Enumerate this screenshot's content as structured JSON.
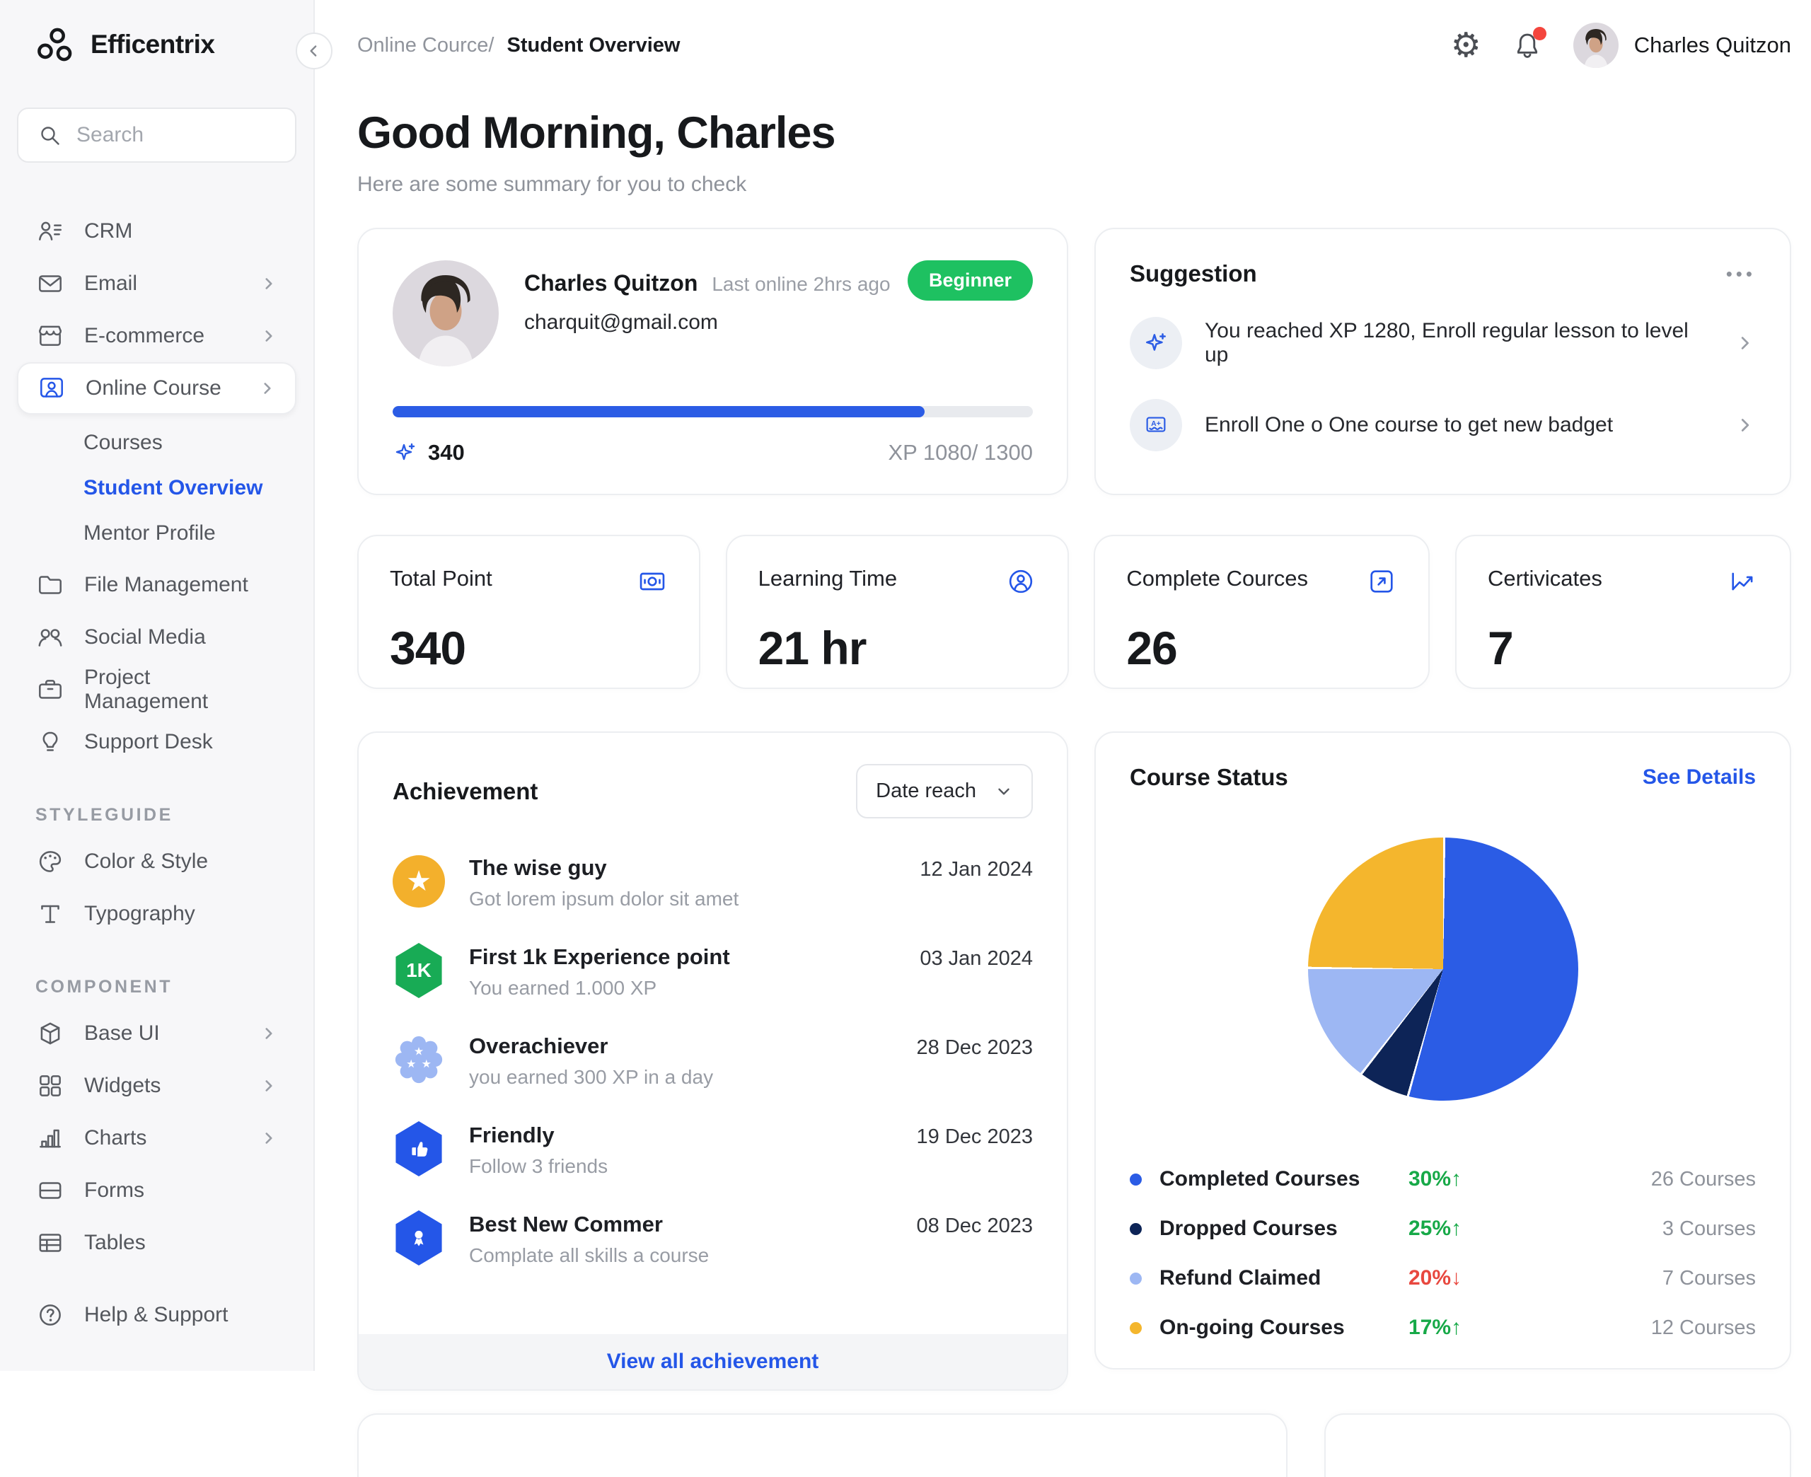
{
  "app": {
    "name": "Efficentrix"
  },
  "colors": {
    "primary_blue": "#2b5ce5",
    "link_blue": "#2456e8",
    "badge_green": "#1ec161",
    "trend_green": "#17a948",
    "trend_red": "#e8483f",
    "navy": "#0d2457",
    "light_blue": "#9db7f3",
    "yellow": "#f4b62d"
  },
  "icons": {
    "gear": "⚙",
    "more": "•••"
  },
  "sidebar": {
    "search_placeholder": "Search",
    "menu": [
      "CRM",
      "Email",
      "E-commerce",
      "Online Course"
    ],
    "online_course_children": [
      "Courses",
      "Student Overview",
      "Mentor Profile"
    ],
    "menu2": [
      "File Management",
      "Social Media",
      "Project Management",
      "Support Desk"
    ],
    "styleguide_label": "STYLEGUIDE",
    "styleguide_items": [
      "Color & Style",
      "Typography"
    ],
    "component_label": "COMPONENT",
    "component_items": [
      "Base UI",
      "Widgets",
      "Charts",
      "Forms",
      "Tables"
    ],
    "help_label": "Help & Support"
  },
  "header": {
    "breadcrumb_parent": "Online Cource/",
    "breadcrumb_current": "Student Overview",
    "user_name": "Charles Quitzon"
  },
  "greeting": {
    "title": "Good Morning, Charles",
    "subtitle": "Here are some summary for you to check"
  },
  "profile_card": {
    "name": "Charles Quitzon",
    "last_online": "Last online 2hrs ago",
    "email": "charquit@gmail.com",
    "level_badge": "Beginner",
    "points": "340",
    "xp_label": "XP 1080/ 1300",
    "xp_current": 1080,
    "xp_max": 1300
  },
  "suggestion_card": {
    "title": "Suggestion",
    "items": [
      {
        "text": "You reached XP 1280, Enroll regular lesson to level up"
      },
      {
        "text": "Enroll One o One course to get new badget"
      }
    ]
  },
  "stats": [
    {
      "label": "Total Point",
      "value": "340"
    },
    {
      "label": "Learning Time",
      "value": "21 hr"
    },
    {
      "label": "Complete Cources",
      "value": "26"
    },
    {
      "label": "Certivicates",
      "value": "7"
    }
  ],
  "achievement_card": {
    "title": "Achievement",
    "filter_label": "Date reach",
    "footer_link": "View all achievement",
    "items": [
      {
        "title": "The wise guy",
        "desc": "Got lorem ipsum dolor sit amet",
        "date": "12 Jan 2024",
        "icon_glyph": "★"
      },
      {
        "title": "First 1k Experience point",
        "desc": "You earned 1.000 XP",
        "date": "03 Jan 2024",
        "badge_text": "1K"
      },
      {
        "title": "Overachiever",
        "desc": "you earned 300 XP in a day",
        "date": "28 Dec 2023"
      },
      {
        "title": "Friendly",
        "desc": "Follow 3 friends",
        "date": "19 Dec 2023"
      },
      {
        "title": "Best New Commer",
        "desc": "Complate all skills a course",
        "date": "08 Dec 2023"
      }
    ]
  },
  "course_status_card": {
    "title": "Course Status",
    "link_label": "See Details"
  },
  "chart_data": {
    "type": "pie",
    "title": "Course Status",
    "labels": [
      "Completed Courses",
      "Dropped Courses",
      "Refund Claimed",
      "On-going Courses"
    ],
    "values": [
      26,
      3,
      7,
      12
    ],
    "unit": "Courses",
    "colors": [
      "#2b5ce5",
      "#0d2457",
      "#9db7f3",
      "#f4b62d"
    ],
    "start_angle_deg": 0,
    "legend_position": "bottom",
    "legend": [
      {
        "label": "Completed Courses",
        "trend": "30%",
        "arrow": "↑",
        "trend_color": "#17a948",
        "count": "26 Courses",
        "dot_color": "#2b5ce5"
      },
      {
        "label": "Dropped Courses",
        "trend": "25%",
        "arrow": "↑",
        "trend_color": "#17a948",
        "count": "3 Courses",
        "dot_color": "#0d2457"
      },
      {
        "label": "Refund Claimed",
        "trend": "20%",
        "arrow": "↓",
        "trend_color": "#e8483f",
        "count": "7 Courses",
        "dot_color": "#9db7f3"
      },
      {
        "label": "On-going Courses",
        "trend": "17%",
        "arrow": "↑",
        "trend_color": "#17a948",
        "count": "12 Courses",
        "dot_color": "#f4b62d"
      }
    ]
  }
}
